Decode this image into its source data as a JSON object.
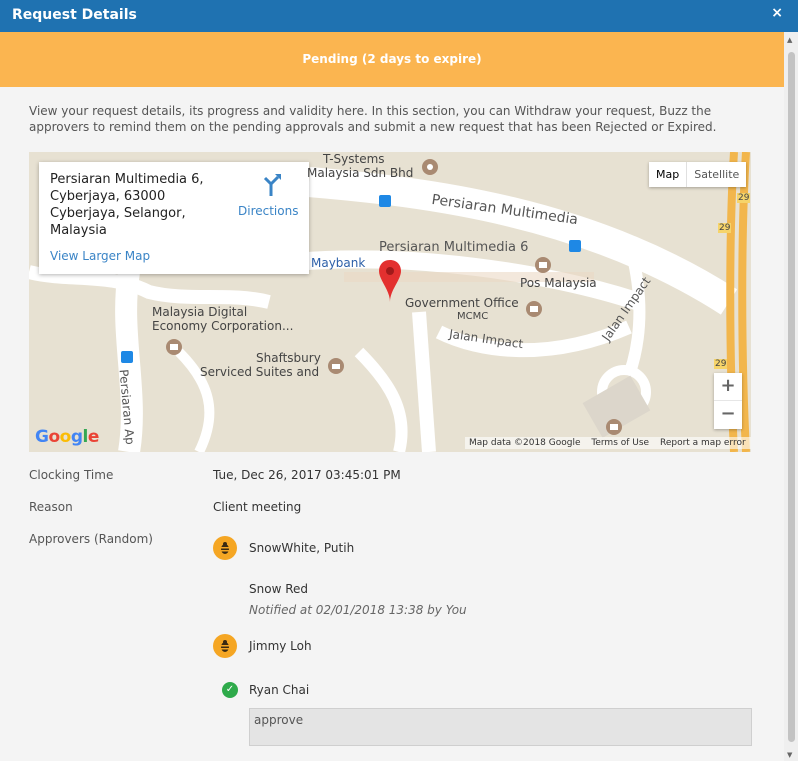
{
  "window": {
    "title": "Request Details",
    "close_glyph": "×"
  },
  "banner": {
    "text": "Pending (2 days to expire)",
    "color": "#fbb550"
  },
  "description": "View your request details, its progress and validity here. In this section, you can Withdraw your request, Buzz the approvers to remind them on the pending approvals and submit a new request that has been Rejected or Expired.",
  "map": {
    "infocard": {
      "address": "Persiaran Multimedia 6, Cyberjaya, 63000 Cyberjaya, Selangor, Malaysia",
      "directions_label": "Directions",
      "larger_map_label": "View Larger Map"
    },
    "map_type": {
      "map_label": "Map",
      "satellite_label": "Satellite",
      "selected": "Map"
    },
    "zoom": {
      "in_label": "+",
      "out_label": "−"
    },
    "labels": {
      "tsystems_1": "T-Systems",
      "tsystems_2": "Malaysia Sdn Bhd",
      "persiaran_multimedia": "Persiaran Multimedia",
      "persiaran_multimedia_6": "Persiaran Multimedia 6",
      "maybank": "Maybank",
      "pos_malaysia": "Pos Malaysia",
      "government_office": "Government Office",
      "mcmc": "MCMC",
      "mdec_1": "Malaysia Digital",
      "mdec_2": "Economy Corporation...",
      "jalan_impact_1": "Jalan Impact",
      "jalan_impact_2": "Jalan Impact",
      "shaftsbury_1": "Shaftsbury",
      "shaftsbury_2": "Serviced Suites and",
      "persiaran_ap": "Persiaran Ap",
      "highway_29_a": "29",
      "highway_29_b": "29",
      "highway_29_c": "29"
    },
    "attribution": {
      "map_data": "Map data ©2018 Google",
      "terms": "Terms of Use",
      "report": "Report a map error"
    },
    "logo_letters": [
      {
        "ch": "G",
        "color": "#4285f4"
      },
      {
        "ch": "o",
        "color": "#ea4335"
      },
      {
        "ch": "o",
        "color": "#fbbc05"
      },
      {
        "ch": "g",
        "color": "#4285f4"
      },
      {
        "ch": "l",
        "color": "#34a853"
      },
      {
        "ch": "e",
        "color": "#ea4335"
      }
    ]
  },
  "details": {
    "clocking_time_label": "Clocking Time",
    "clocking_time_value": "Tue, Dec 26, 2017 03:45:01 PM",
    "reason_label": "Reason",
    "reason_value": "Client meeting",
    "approvers_label": "Approvers (Random)",
    "approvers": [
      {
        "name": "SnowWhite, Putih",
        "status_icon": "pending-bee-icon"
      },
      {
        "name": "Snow Red",
        "note": "Notified at 02/01/2018 13:38 by You"
      },
      {
        "name": "Jimmy Loh",
        "status_icon": "pending-bee-icon"
      },
      {
        "name": "Ryan Chai",
        "status_icon": "check-circle-icon",
        "comment": "approve"
      }
    ]
  },
  "colors": {
    "titlebar": "#1f72b1",
    "accent_link": "#3a84c6",
    "pending": "#f5a623",
    "approved": "#2eaa4a"
  }
}
